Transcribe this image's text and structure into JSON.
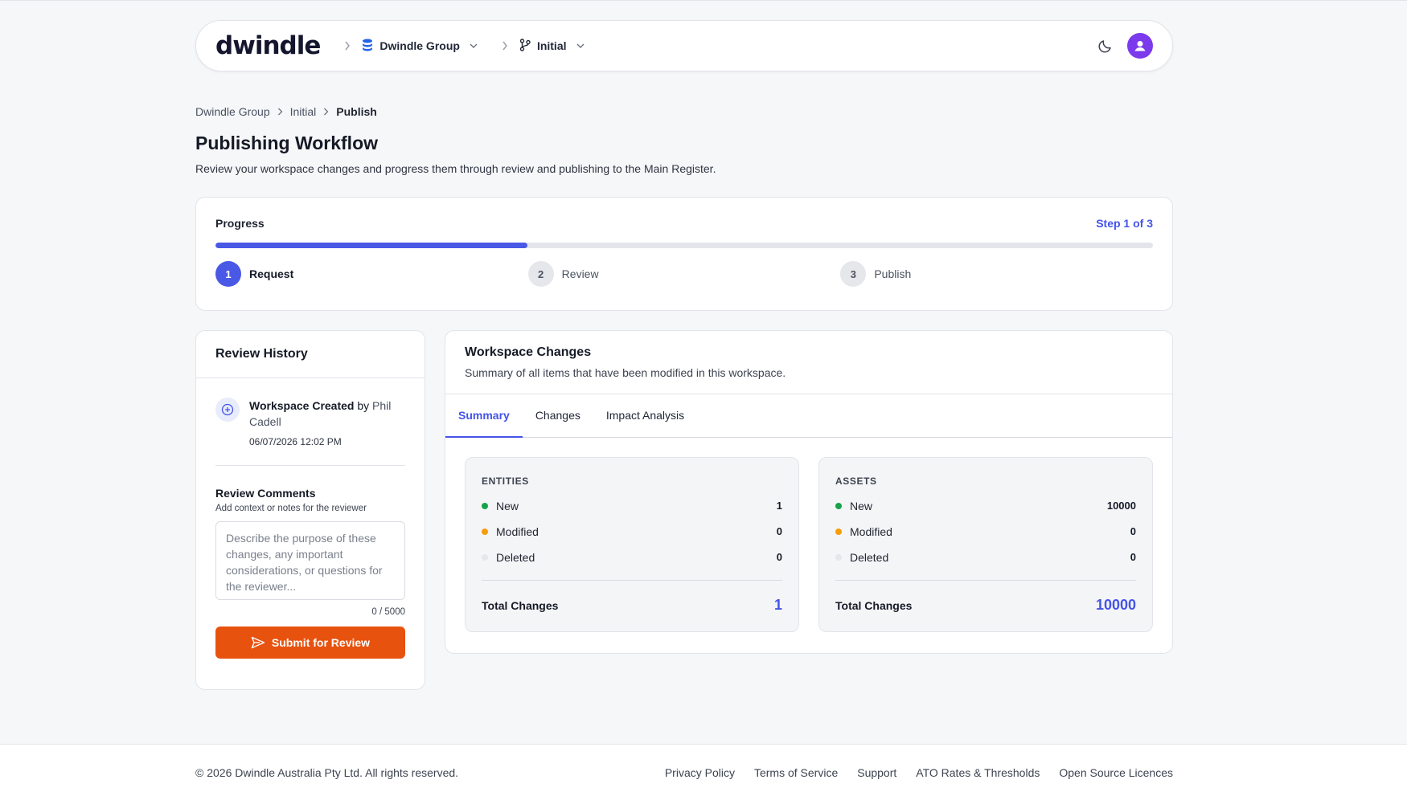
{
  "header": {
    "logo": "dwindle",
    "org_selector": "Dwindle Group",
    "branch_selector": "Initial",
    "icons": [
      "dark-mode-icon",
      "user-avatar-icon"
    ]
  },
  "breadcrumb": {
    "items": [
      "Dwindle Group",
      "Initial"
    ],
    "current": "Publish"
  },
  "page": {
    "title": "Publishing Workflow",
    "subtitle": "Review your workspace changes and progress them through review and publishing to the Main Register."
  },
  "progress": {
    "label": "Progress",
    "step_text": "Step 1 of 3",
    "fraction_complete": 0.333,
    "steps": [
      {
        "num": "1",
        "label": "Request",
        "active": true
      },
      {
        "num": "2",
        "label": "Review",
        "active": false
      },
      {
        "num": "3",
        "label": "Publish",
        "active": false
      }
    ]
  },
  "history": {
    "title": "Review History",
    "entry": {
      "event": "Workspace Created",
      "by_word": "by",
      "actor": "Phil Cadell",
      "timestamp": "06/07/2026 12:02 PM"
    },
    "comments_title": "Review Comments",
    "comments_sub": "Add context or notes for the reviewer",
    "comments_placeholder": "Describe the purpose of these changes, any important considerations, or questions for the reviewer...",
    "comments_value": "",
    "char_count": "0 / 5000",
    "submit_label": "Submit for Review"
  },
  "changes": {
    "title": "Workspace Changes",
    "subtitle": "Summary of all items that have been modified in this workspace.",
    "tabs": [
      {
        "label": "Summary",
        "active": true
      },
      {
        "label": "Changes",
        "active": false
      },
      {
        "label": "Impact Analysis",
        "active": false
      }
    ],
    "entities": {
      "title": "ENTITIES",
      "new_label": "New",
      "new": "1",
      "modified_label": "Modified",
      "modified": "0",
      "deleted_label": "Deleted",
      "deleted": "0",
      "total_label": "Total Changes",
      "total": "1"
    },
    "assets": {
      "title": "ASSETS",
      "new_label": "New",
      "new": "10000",
      "modified_label": "Modified",
      "modified": "0",
      "deleted_label": "Deleted",
      "deleted": "0",
      "total_label": "Total Changes",
      "total": "10000"
    },
    "colors": {
      "new": "#16a34a",
      "modified": "#f59e0b",
      "deleted": "#e5e7eb"
    }
  },
  "footer": {
    "copyright": "© 2026 Dwindle Australia Pty Ltd. All rights reserved.",
    "links": [
      "Privacy Policy",
      "Terms of Service",
      "Support",
      "ATO Rates & Thresholds",
      "Open Source Licences"
    ]
  },
  "colors": {
    "accent": "#4a58e6",
    "primary_button": "#e8520f"
  }
}
